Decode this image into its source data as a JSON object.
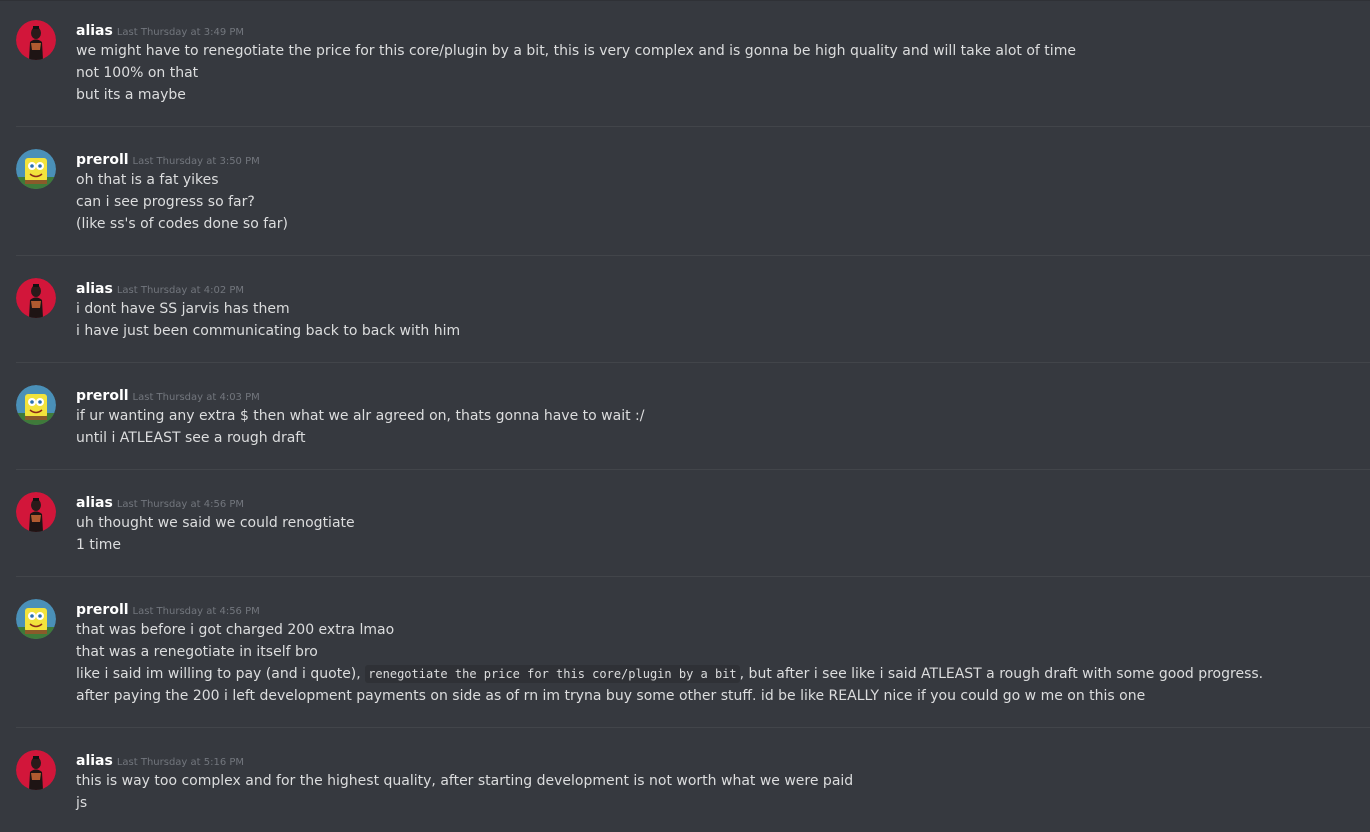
{
  "messages": [
    {
      "author": "alias",
      "avatar": "alias-avatar",
      "timestamp": "Last Thursday at 3:49 PM",
      "lines": [
        "we might have to renegotiate the price for this core/plugin by a bit, this is very complex and is gonna be high quality and will take alot of time",
        "not 100% on that",
        "but its a maybe"
      ]
    },
    {
      "author": "preroll",
      "avatar": "spongebob-avatar",
      "timestamp": "Last Thursday at 3:50 PM",
      "lines": [
        "oh that is a fat yikes",
        "can i see progress so far?",
        "(like ss's of codes done so far)"
      ]
    },
    {
      "author": "alias",
      "avatar": "alias-avatar",
      "timestamp": "Last Thursday at 4:02 PM",
      "lines": [
        "i dont have SS jarvis has them",
        "i have just been communicating back to back with him"
      ]
    },
    {
      "author": "preroll",
      "avatar": "spongebob-avatar",
      "timestamp": "Last Thursday at 4:03 PM",
      "lines": [
        "if ur wanting any extra $ then what we alr agreed on, thats gonna have to wait :/",
        "until i ATLEAST see a rough draft"
      ]
    },
    {
      "author": "alias",
      "avatar": "alias-avatar",
      "timestamp": "Last Thursday at 4:56 PM",
      "lines": [
        "uh thought we said we could renogtiate",
        "1 time"
      ]
    },
    {
      "author": "preroll",
      "avatar": "spongebob-avatar",
      "timestamp": "Last Thursday at 4:56 PM",
      "lines": [
        "that was before i got charged 200 extra lmao",
        "that was a renegotiate in itself bro"
      ],
      "quote_line": {
        "before": "like i said im willing to pay (and i quote), ",
        "code": "renegotiate the price for this core/plugin by a bit",
        "after": ", but after i see like i said ATLEAST a rough draft with some good progress."
      },
      "last_line": "after paying the 200 i left development payments on side as of rn im tryna buy some other stuff. id be like REALLY nice if you could go w me on this one"
    },
    {
      "author": "alias",
      "avatar": "alias-avatar",
      "timestamp": "Last Thursday at 5:16 PM",
      "lines": [
        "this is way too complex and for the highest quality, after starting development is not worth what we were paid",
        "js"
      ]
    }
  ],
  "colors": {
    "background": "#36393f",
    "text": "#dcddde",
    "username": "#ffffff",
    "timestamp": "#72767d",
    "divider": "#42454a"
  }
}
